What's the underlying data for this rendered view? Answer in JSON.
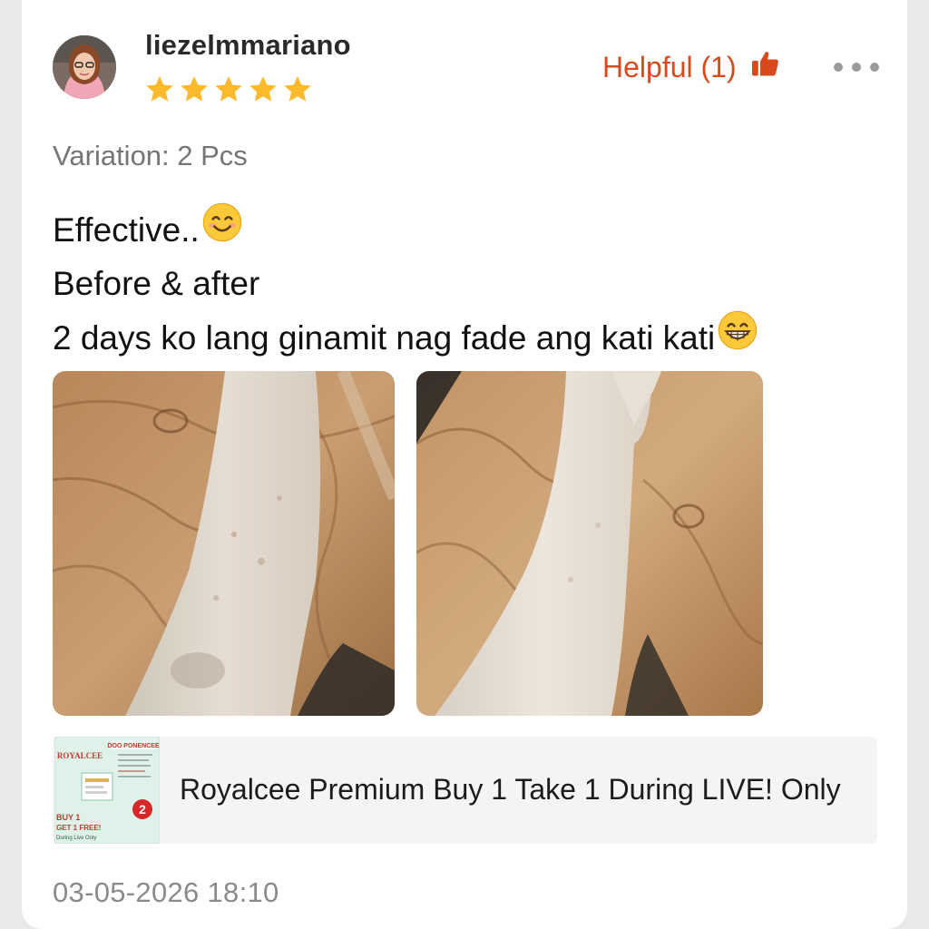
{
  "review": {
    "username": "liezelmmariano",
    "rating": 5,
    "helpful_label": "Helpful (1)",
    "variation": "Variation: 2 Pcs",
    "lines": [
      "Effective..",
      "Before & after",
      "2 days ko lang ginamit nag fade ang kati kati"
    ],
    "emojis": [
      "smiling-face-icon",
      "grinning-face-icon"
    ],
    "timestamp": "03-05-2026 18:10"
  },
  "product": {
    "name": "Royalcee Premium Buy 1 Take 1 During LIVE! Only",
    "thumbnail_text": {
      "brand": "ROYALCEE",
      "header": "DOO PONENCEE",
      "promo_line1": "BUY 1",
      "promo_line2": "GET 1 FREE!",
      "promo_line3": "During Live Only",
      "badge": "2"
    }
  },
  "colors": {
    "helpful": "#d84a1e",
    "star": "#fbb92b",
    "text": "#111111",
    "muted": "#757575"
  },
  "icons": [
    "more-options-icon",
    "thumbs-up-icon",
    "star-icon"
  ]
}
